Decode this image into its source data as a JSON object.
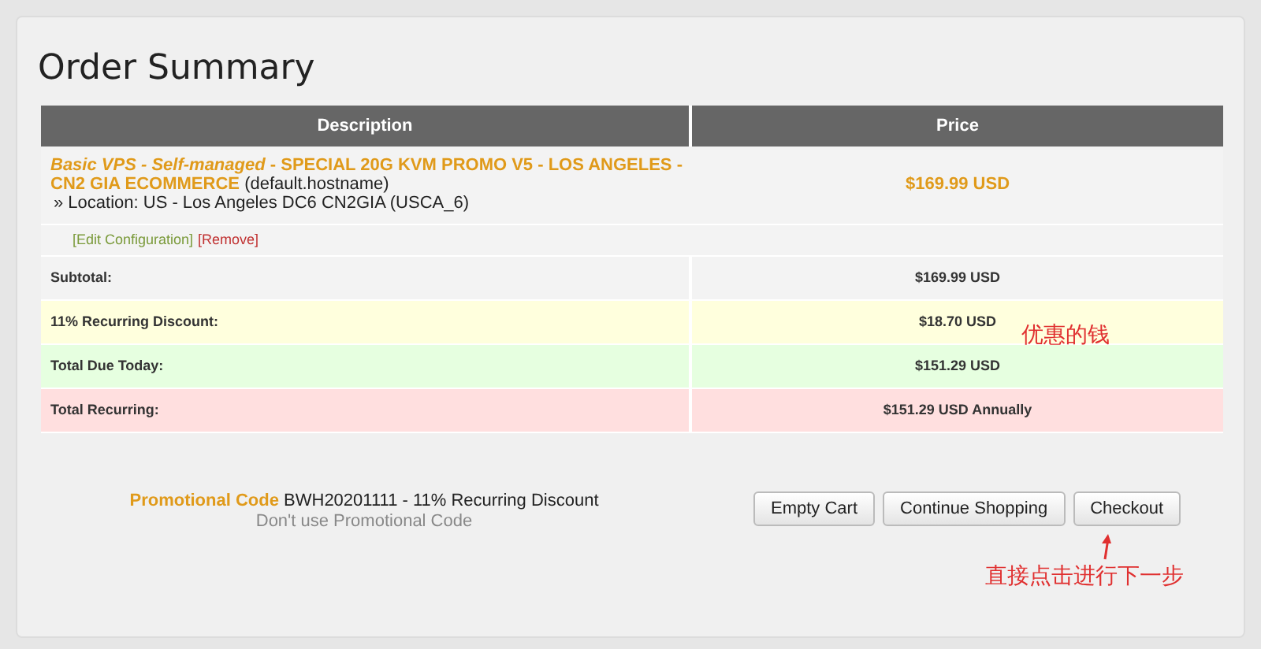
{
  "title": "Order Summary",
  "table": {
    "columns": [
      "Description",
      "Price"
    ],
    "item": {
      "product_group": "Basic VPS - Self-managed",
      "product_name": "- SPECIAL 20G KVM PROMO V5 - LOS ANGELES - CN2 GIA ECOMMERCE",
      "hostname": "(default.hostname)",
      "option": "» Location: US - Los Angeles DC6 CN2GIA (USCA_6)",
      "price": "$169.99 USD",
      "links": [
        {
          "label": "[Edit Configuration]",
          "kind": "edit"
        },
        {
          "label": "[Remove]",
          "kind": "remove"
        }
      ]
    },
    "totals": [
      {
        "label": "Subtotal:",
        "value": "$169.99 USD",
        "color": "#f3f3f3"
      },
      {
        "label": "11% Recurring Discount:",
        "value": "$18.70 USD",
        "color": "#ffffdd"
      },
      {
        "label": "Total Due Today:",
        "value": "$151.29 USD",
        "color": "#e6ffe0"
      },
      {
        "label": "Total Recurring:",
        "value": "$151.29 USD Annually",
        "color": "#ffdfdf"
      }
    ]
  },
  "promo": {
    "label": "Promotional Code",
    "code": "BWH20201111 - 11% Recurring Discount",
    "remove_link": "Don't use Promotional Code"
  },
  "buttons": [
    "Empty Cart",
    "Continue Shopping",
    "Checkout"
  ],
  "annotations": [
    {
      "text": "优惠的钱",
      "kind": "discount"
    },
    {
      "text": "直接点击进行下一步",
      "kind": "checkout"
    }
  ]
}
